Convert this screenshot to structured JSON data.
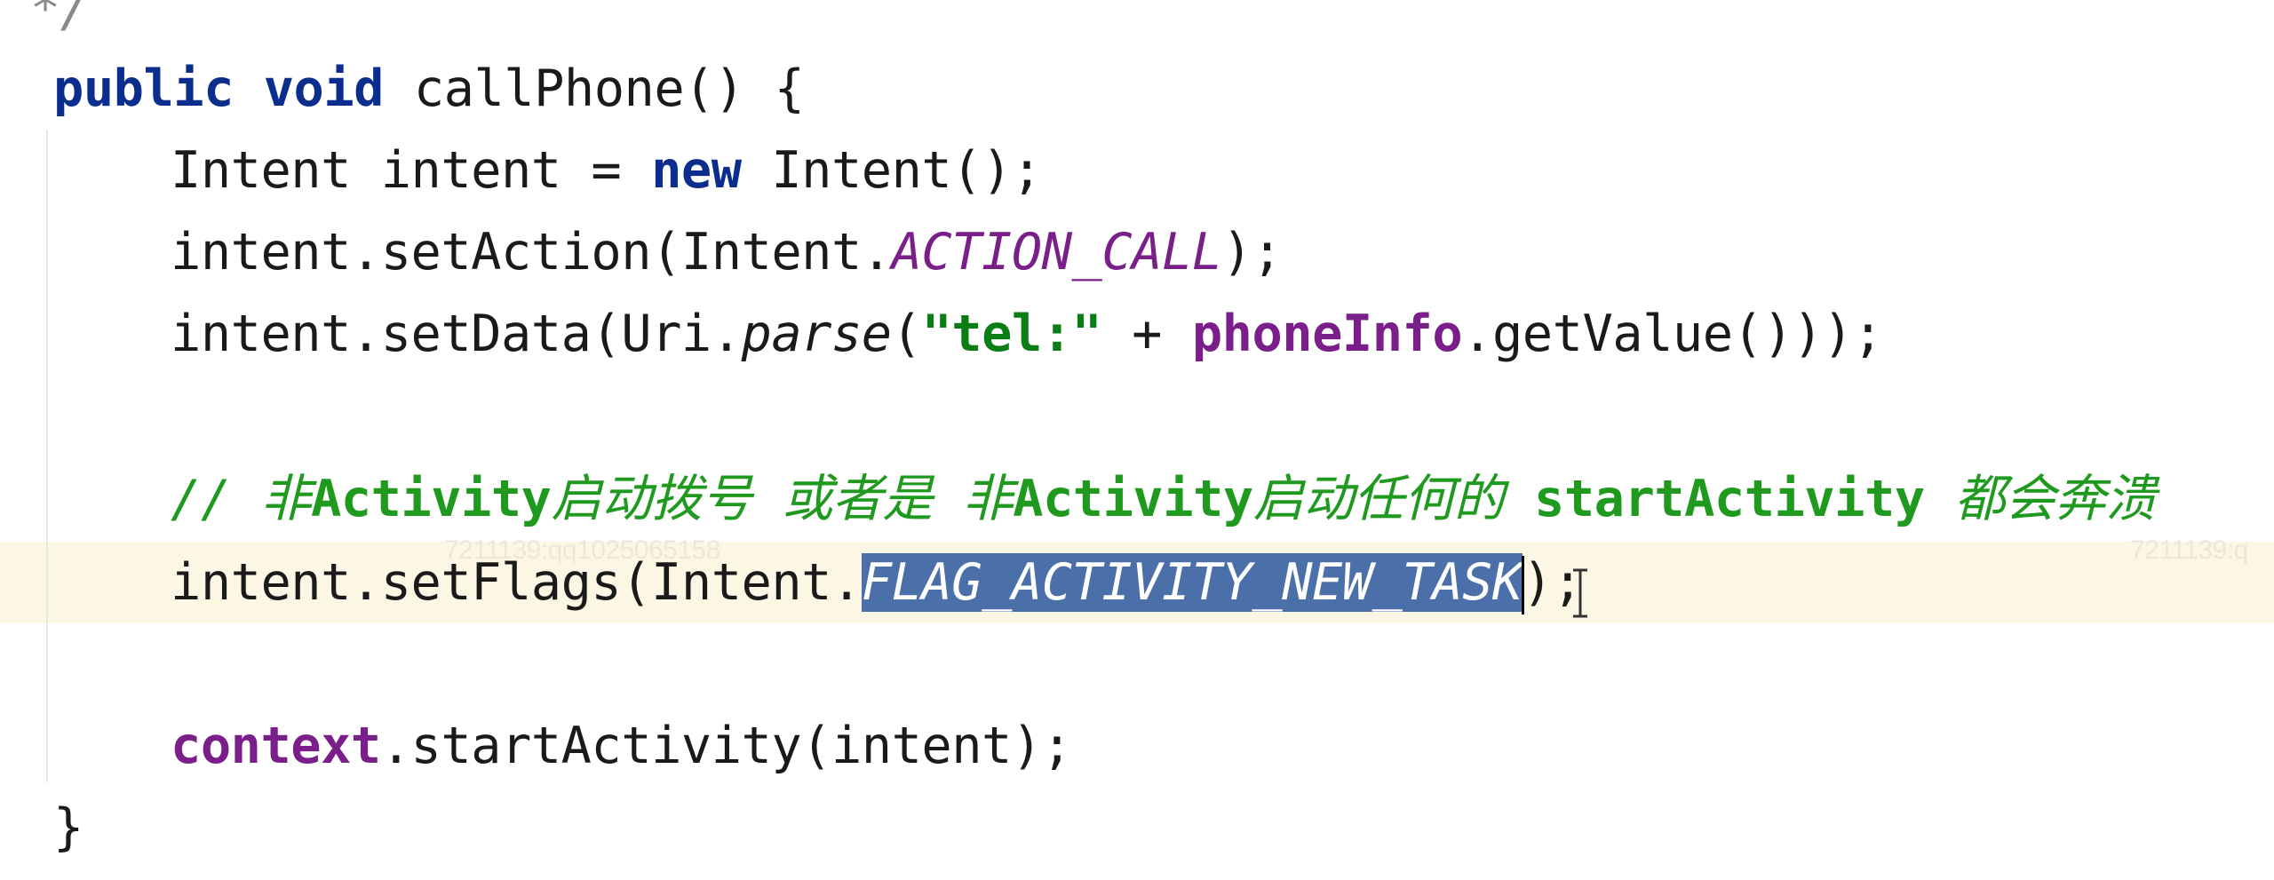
{
  "editor": {
    "doc_end": " */",
    "signature": {
      "modifier": "public",
      "return_type": "void",
      "method_name": " callPhone() {"
    },
    "line1": {
      "type": "Intent intent = ",
      "new_kw": "new",
      "rest": " Intent();"
    },
    "line2": {
      "prefix": "intent.setAction(Intent.",
      "constant": "ACTION_CALL",
      "suffix": ");"
    },
    "line3": {
      "prefix": "intent.setData(Uri.",
      "method": "parse",
      "open": "(",
      "string": "\"tel:\"",
      "plus": " + ",
      "field": "phoneInfo",
      "suffix": ".getValue()));"
    },
    "comment": {
      "slashes": "// ",
      "p1": "非",
      "p2": "Activity",
      "p3": "启动拨号 或者是 非",
      "p4": "Activity",
      "p5": "启动任何的 ",
      "p6": "startActivity",
      "p7": " 都会奔溃"
    },
    "flags_line": {
      "prefix": "intent.setFlags(Intent.",
      "selected_constant": "FLAG_ACTIVITY_NEW_TASK",
      "suffix": ");"
    },
    "start_line": {
      "field": "context",
      "rest": ".startActivity(intent);"
    },
    "close_brace": "}"
  },
  "watermarks": {
    "left": "7211139:qq1025065158",
    "right": "7211139:q"
  },
  "icons": {
    "cursor": "text-cursor-icon"
  },
  "colors": {
    "keyword": "#0b2e8e",
    "field": "#7a1f8a",
    "string": "#0a7d14",
    "comment": "#1f9a1f",
    "selection": "#4b6fa8",
    "caret_line": "#fcf6e4"
  }
}
